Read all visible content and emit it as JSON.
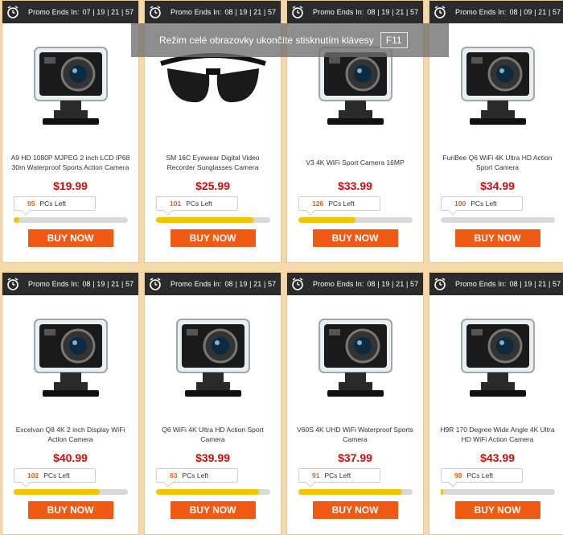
{
  "promo_label": "Promo Ends In:",
  "buy_label": "BUY NOW",
  "pcs_label": "PCs Left",
  "fullscreen_toast": {
    "text": "Režim celé obrazovky ukončíte stisknutím klávesy",
    "key": "F11"
  },
  "colors": {
    "accent": "#f05a14",
    "price": "#d20a0a",
    "bar": "#f4c400",
    "bg": "#f6d9a8",
    "header": "#2b2b2b"
  },
  "products": [
    {
      "timer": "07 | 19 | 21 | 57",
      "title": "A9 HD 1080P MJPEG 2 inch LCD IP68 30m Waterproof Sports Action Camera",
      "price": "$19.99",
      "left": "95",
      "progress": 0.05,
      "image": "action-camera"
    },
    {
      "timer": "08 | 19 | 21 | 57",
      "title": "SM 16C Eyewear Digital Video Recorder Sunglasses Camera",
      "price": "$25.99",
      "left": "101",
      "progress": 0.85,
      "image": "sunglasses-camera"
    },
    {
      "timer": "08 | 19 | 21 | 57",
      "title": "V3 4K WiFi Sport Camera 16MP",
      "price": "$33.99",
      "left": "126",
      "progress": 0.5,
      "image": "action-camera"
    },
    {
      "timer": "08 | 09 | 21 | 57",
      "title": "FuriBee Q6 WiFi 4K Ultra HD Action Sport Camera",
      "price": "$34.99",
      "left": "100",
      "progress": 0.0,
      "image": "action-camera"
    },
    {
      "timer": "08 | 19 | 21 | 57",
      "title": "Excelvan Q8 4K 2 inch Display WiFi Action Camera",
      "price": "$40.99",
      "left": "102",
      "progress": 0.75,
      "image": "action-camera"
    },
    {
      "timer": "08 | 19 | 21 | 57",
      "title": "Q6 WiFi 4K Ultra HD Action Sport Camera",
      "price": "$39.99",
      "left": "63",
      "progress": 0.9,
      "image": "action-camera"
    },
    {
      "timer": "08 | 19 | 21 | 57",
      "title": "V60S 4K UHD WiFi Waterproof Sports Camera",
      "price": "$37.99",
      "left": "91",
      "progress": 0.91,
      "image": "action-camera"
    },
    {
      "timer": "08 | 19 | 21 | 57",
      "title": "H9R 170 Degree Wide Angle 4K Ultra HD WiFi Action Camera",
      "price": "$43.99",
      "left": "98",
      "progress": 0.02,
      "image": "action-camera"
    }
  ]
}
